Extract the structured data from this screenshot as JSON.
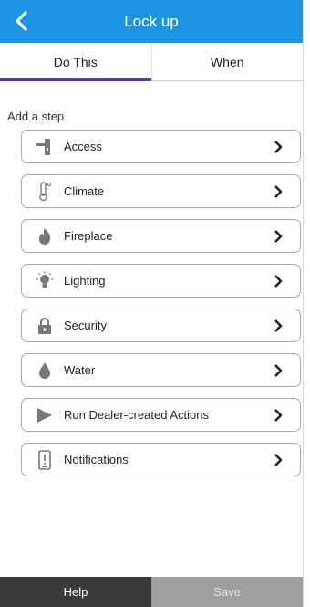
{
  "header": {
    "title": "Lock up"
  },
  "tabs": [
    {
      "label": "Do This",
      "active": true
    },
    {
      "label": "When",
      "active": false
    }
  ],
  "section": {
    "label": "Add a step"
  },
  "steps": [
    {
      "label": "Access",
      "icon": "door-handle-icon"
    },
    {
      "label": "Climate",
      "icon": "thermometer-icon"
    },
    {
      "label": "Fireplace",
      "icon": "flame-icon"
    },
    {
      "label": "Lighting",
      "icon": "lightbulb-icon"
    },
    {
      "label": "Security",
      "icon": "lock-icon"
    },
    {
      "label": "Water",
      "icon": "water-drop-icon"
    },
    {
      "label": "Run Dealer-created Actions",
      "icon": "play-icon"
    },
    {
      "label": "Notifications",
      "icon": "phone-alert-icon"
    }
  ],
  "footer": {
    "help_label": "Help",
    "save_label": "Save"
  },
  "colors": {
    "header": "#1a95e2",
    "tab_indicator": "#5b3a8f",
    "help_bg": "#3a3a3a",
    "save_bg": "#9e9e9e"
  }
}
